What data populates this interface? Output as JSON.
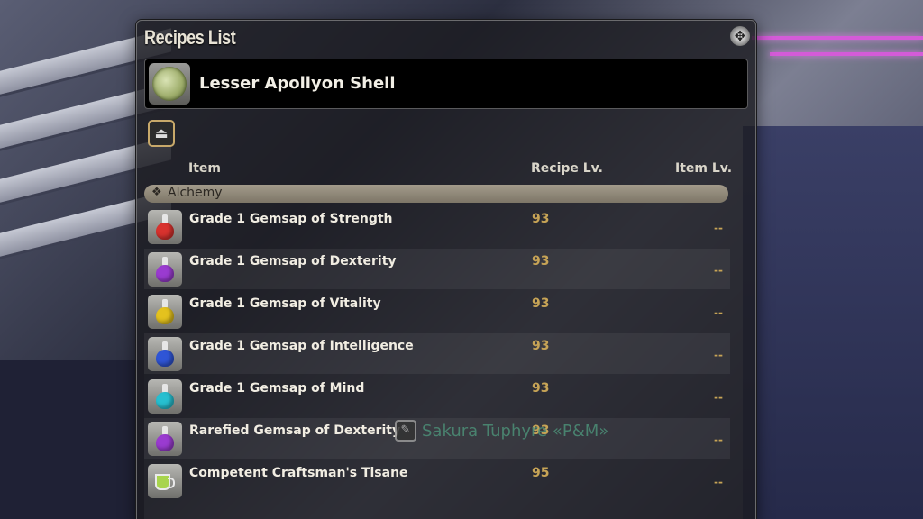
{
  "window": {
    "title": "Recipes List",
    "close_symbol": "✥"
  },
  "search": {
    "item_name": "Lesser Apollyon Shell",
    "item_icon": "shell-icon"
  },
  "filter": {
    "icon": "filter-icon",
    "symbol": "⏏"
  },
  "columns": {
    "item": "Item",
    "recipe_lv": "Recipe Lv.",
    "item_lv": "Item Lv."
  },
  "category": {
    "icon_symbol": "❖",
    "label": "Alchemy"
  },
  "recipes": [
    {
      "name": "Grade 1 Gemsap of Strength",
      "recipe_lv": "93",
      "item_lv": "--",
      "icon": "red-potion-icon",
      "color": "#d8322e"
    },
    {
      "name": "Grade 1 Gemsap of Dexterity",
      "recipe_lv": "93",
      "item_lv": "--",
      "icon": "purple-potion-icon",
      "color": "#9a3bd0"
    },
    {
      "name": "Grade 1 Gemsap of Vitality",
      "recipe_lv": "93",
      "item_lv": "--",
      "icon": "yellow-potion-icon",
      "color": "#e4c21e"
    },
    {
      "name": "Grade 1 Gemsap of Intelligence",
      "recipe_lv": "93",
      "item_lv": "--",
      "icon": "blue-potion-icon",
      "color": "#2f55d6"
    },
    {
      "name": "Grade 1 Gemsap of Mind",
      "recipe_lv": "93",
      "item_lv": "--",
      "icon": "cyan-potion-icon",
      "color": "#27bfd0"
    },
    {
      "name": "Rarefied Gemsap of Dexterity",
      "recipe_lv": "93",
      "item_lv": "--",
      "icon": "purple-potion-icon",
      "color": "#9a3bd0"
    },
    {
      "name": "Competent Craftsman's Tisane",
      "recipe_lv": "95",
      "item_lv": "--",
      "icon": "tisane-cup-icon",
      "color": "#a8d44d"
    }
  ],
  "nameplate": {
    "text": "Sakura Tuphyre «P&M»",
    "icon_symbol": "✎"
  }
}
